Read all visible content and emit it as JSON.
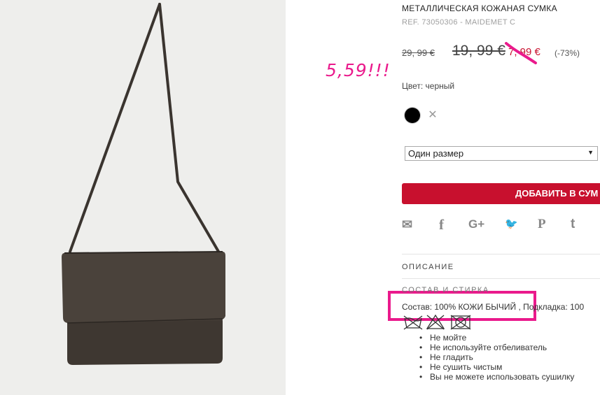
{
  "product": {
    "title": "МЕТАЛЛИЧЕСКАЯ КОЖАНАЯ СУМКА",
    "ref": "REF. 73050306 - MAIDEMET C",
    "image_alt": "metallic-leather-bag-photo"
  },
  "price": {
    "original": "29, 99 €",
    "previous": "19, 99 €",
    "current": "7, 99 €",
    "discount": "(-73%)"
  },
  "handwritten_note": "5,59!!!",
  "color": {
    "label": "Цвет: черный",
    "selected": "#000000"
  },
  "size": {
    "selected": "Один размер"
  },
  "add_to_cart": {
    "label": "ДОБАВИТЬ В СУМ"
  },
  "share_icons": [
    "mail-icon",
    "facebook-icon",
    "google-plus-icon",
    "twitter-icon",
    "pinterest-icon",
    "tumblr-icon"
  ],
  "share_glyphs": {
    "mail": "✉",
    "facebook": "f",
    "gplus": "G+",
    "twitter": "🐦",
    "pinterest": "P",
    "tumblr": "t"
  },
  "sections": {
    "description": "ОПИСАНИЕ",
    "composition": "СОСТАВ И СТИРКА"
  },
  "composition_text": "Состав: 100% КОЖИ БЫЧИЙ , Подкладка: 100",
  "care": {
    "icons": [
      "no-wash-icon",
      "no-bleach-icon",
      "no-tumble-dry-icon"
    ],
    "items": [
      "Не мойте",
      "Не используйте отбеливатель",
      "Не гладить",
      "Не сушить чистым",
      "Вы не можете использовать сушилку"
    ]
  },
  "colors": {
    "accent": "#c8102e",
    "highlight": "#ea1a8c"
  }
}
